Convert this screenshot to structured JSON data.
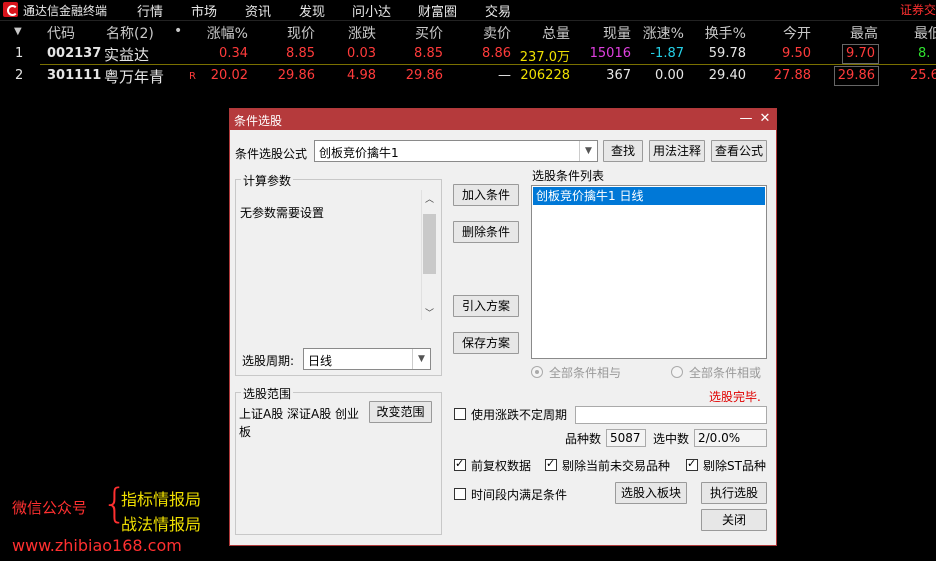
{
  "app": {
    "title": "通达信金融终端",
    "menu": [
      "行情",
      "市场",
      "资讯",
      "发现",
      "问小达",
      "财富圈",
      "交易"
    ],
    "right_link": "证券交"
  },
  "table": {
    "columns": [
      "代码",
      "名称(2)",
      "•",
      "涨幅%",
      "现价",
      "涨跌",
      "买价",
      "卖价",
      "总量",
      "现量",
      "涨速%",
      "换手%",
      "今开",
      "最高",
      "最低"
    ],
    "rows": [
      {
        "idx": "1",
        "code": "002137",
        "name": "实益达",
        "flag": "",
        "change_pct": "0.34",
        "price": "8.85",
        "change": "0.03",
        "bid": "8.85",
        "ask": "8.86",
        "volume": "237.0万",
        "cur_vol": "15016",
        "speed": "-1.87",
        "turnover": "59.78",
        "open": "9.50",
        "high": "9.70",
        "low": "8."
      },
      {
        "idx": "2",
        "code": "301111",
        "name": "粤万年青",
        "flag": "R",
        "change_pct": "20.02",
        "price": "29.86",
        "change": "4.98",
        "bid": "29.86",
        "ask": "—",
        "volume": "206228",
        "cur_vol": "367",
        "speed": "0.00",
        "turnover": "29.40",
        "open": "27.88",
        "high": "29.86",
        "low": "25.6"
      }
    ]
  },
  "dialog": {
    "title": "条件选股",
    "minimize": "—",
    "close": "✕",
    "formula_label": "条件选股公式",
    "formula_value": "创板竞价擒牛1",
    "find_btn": "查找",
    "usage_btn": "用法注释",
    "view_formula_btn": "查看公式",
    "params_group": "计算参数",
    "params_text": "无参数需要设置",
    "period_label": "选股周期:",
    "period_value": "日线",
    "add_cond_btn": "加入条件",
    "del_cond_btn": "删除条件",
    "import_plan_btn": "引入方案",
    "save_plan_btn": "保存方案",
    "cond_list_label": "选股条件列表",
    "cond_list": [
      "创板竞价擒牛1  日线"
    ],
    "radio_and": "全部条件相与",
    "radio_or": "全部条件相或",
    "status": "选股完毕.",
    "range_group": "选股范围",
    "range_text": "上证A股 深证A股 创业板",
    "change_range_btn": "改变范围",
    "use_period_label": "使用涨跌不定周期",
    "count_label": "品种数",
    "count_value": "5087",
    "selected_label": "选中数",
    "selected_value": "2/0.0%",
    "fq_label": "前复权数据",
    "exclude_untraded_label": "剔除当前未交易品种",
    "exclude_st_label": "剔除ST品种",
    "time_range_label": "时间段内满足条件",
    "to_block_btn": "选股入板块",
    "run_btn": "执行选股",
    "close_btn": "关闭"
  },
  "watermark": {
    "wechat": "微信公众号",
    "brace": "{",
    "line1": "指标情报局",
    "line2": "战法情报局",
    "url": "www.zhibiao168.com"
  },
  "colors": {
    "up": "#ff3b3b",
    "volume": "#f0e000",
    "cur_vol": "#e040e0",
    "speed_down": "#25d0e6",
    "low": "#2fe02f",
    "dialog_title": "#b53a3c",
    "status_red": "#e00000"
  }
}
